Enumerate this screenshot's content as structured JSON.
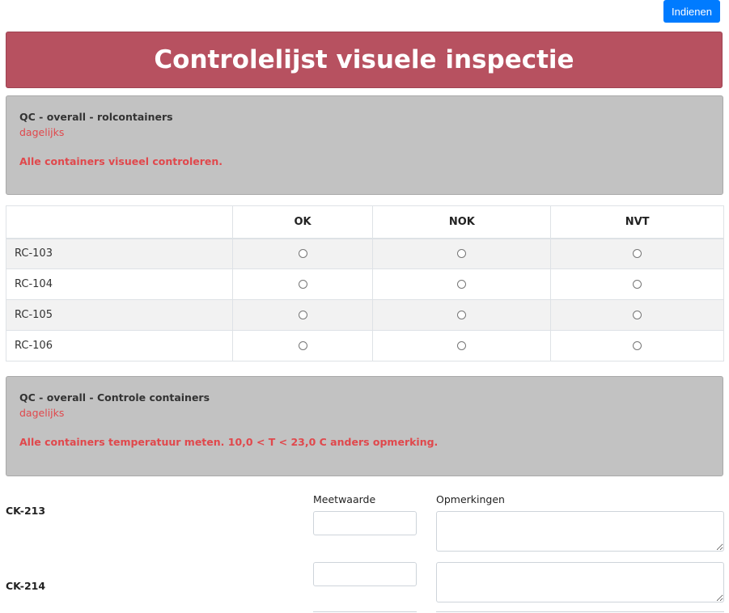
{
  "toolbar": {
    "submit_label": "Indienen"
  },
  "header": {
    "title": "Controlelijst visuele inspectie"
  },
  "sections": [
    {
      "title": "QC - overall - rolcontainers",
      "frequency": "dagelijks",
      "instruction": "Alle containers visueel controleren."
    },
    {
      "title": "QC - overall - Controle containers",
      "frequency": "dagelijks",
      "instruction": "Alle containers temperatuur meten. 10,0 < T < 23,0 C anders opmerking."
    }
  ],
  "check_table": {
    "columns": [
      "",
      "OK",
      "NOK",
      "NVT"
    ],
    "rows": [
      {
        "label": "RC-103"
      },
      {
        "label": "RC-104"
      },
      {
        "label": "RC-105"
      },
      {
        "label": "RC-106"
      }
    ]
  },
  "measurements": {
    "value_header": "Meetwaarde",
    "remarks_header": "Opmerkingen",
    "rows": [
      {
        "label": "CK-213",
        "value": "",
        "remarks": ""
      },
      {
        "label": "CK-214",
        "value": "",
        "remarks": ""
      }
    ]
  },
  "colors": {
    "banner": "#b75160",
    "card": "#c2c2c2",
    "accent_red": "#e0484c",
    "primary_button": "#007bff"
  }
}
